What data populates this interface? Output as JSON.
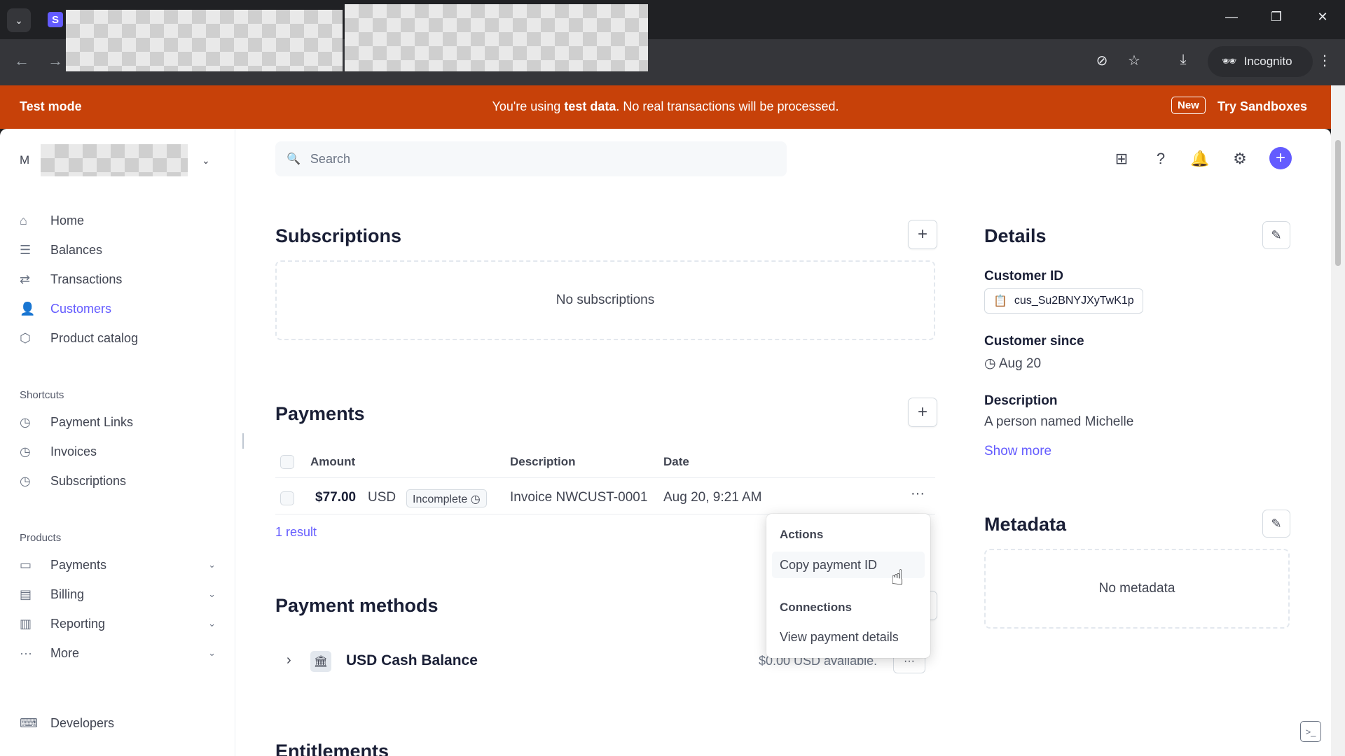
{
  "browser": {
    "incognito_label": "Incognito"
  },
  "banner": {
    "left": "Test mode",
    "message_prefix": "You're using ",
    "message_bold": "test data",
    "message_suffix": ". No real transactions will be processed.",
    "new_badge": "New",
    "cta": "Try Sandboxes"
  },
  "account": {
    "initial": "M"
  },
  "sidebar": {
    "main": [
      {
        "label": "Home",
        "icon": "home-icon"
      },
      {
        "label": "Balances",
        "icon": "balances-icon"
      },
      {
        "label": "Transactions",
        "icon": "transactions-icon"
      },
      {
        "label": "Customers",
        "icon": "customers-icon",
        "active": true
      },
      {
        "label": "Product catalog",
        "icon": "product-catalog-icon"
      }
    ],
    "shortcuts_label": "Shortcuts",
    "shortcuts": [
      {
        "label": "Payment Links",
        "icon": "clock-icon"
      },
      {
        "label": "Invoices",
        "icon": "clock-icon"
      },
      {
        "label": "Subscriptions",
        "icon": "clock-icon"
      }
    ],
    "products_label": "Products",
    "products": [
      {
        "label": "Payments",
        "icon": "payments-icon"
      },
      {
        "label": "Billing",
        "icon": "billing-icon"
      },
      {
        "label": "Reporting",
        "icon": "reporting-icon"
      },
      {
        "label": "More",
        "icon": "more-icon"
      }
    ],
    "developers": "Developers"
  },
  "search": {
    "placeholder": "Search"
  },
  "subscriptions": {
    "title": "Subscriptions",
    "empty": "No subscriptions"
  },
  "payments": {
    "title": "Payments",
    "columns": [
      "Amount",
      "Description",
      "Date"
    ],
    "rows": [
      {
        "amount": "$77.00",
        "currency": "USD",
        "status": "Incomplete",
        "description": "Invoice NWCUST-0001",
        "date": "Aug 20, 9:21 AM"
      }
    ],
    "result_count": "1 result"
  },
  "context_menu": {
    "actions_label": "Actions",
    "copy_id": "Copy payment ID",
    "connections_label": "Connections",
    "view_details": "View payment details"
  },
  "payment_methods": {
    "title": "Payment methods",
    "cash_balance_label": "USD Cash Balance",
    "cash_balance_value": "$0.00 USD available."
  },
  "entitlements": {
    "title": "Entitlements"
  },
  "details": {
    "title": "Details",
    "customer_id_label": "Customer ID",
    "customer_id": "cus_Su2BNYJXyTwK1p",
    "customer_since_label": "Customer since",
    "customer_since": "Aug 20",
    "description_label": "Description",
    "description": "A person named Michelle",
    "show_more": "Show more"
  },
  "metadata": {
    "title": "Metadata",
    "empty": "No metadata"
  },
  "colors": {
    "accent": "#635bff",
    "banner": "#c74109"
  }
}
